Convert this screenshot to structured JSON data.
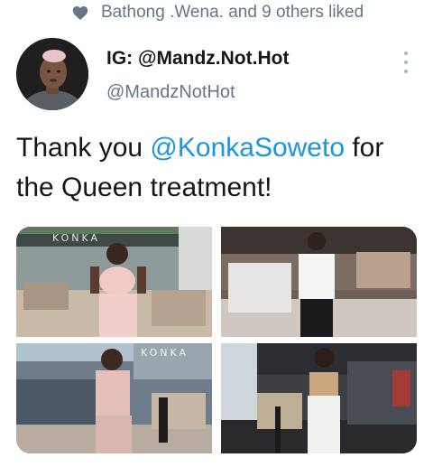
{
  "social_context": {
    "icon": "heart-icon",
    "text": "Bathong .Wena. and 9 others liked"
  },
  "author": {
    "display_name": "IG: @Mandz.Not.Hot",
    "handle": "@MandzNotHot"
  },
  "tweet": {
    "text_before": "Thank you ",
    "mention": "@KonkaSoweto",
    "text_after": " for the Queen treatment!"
  },
  "media": {
    "photos": [
      {
        "sign": "KONKA"
      },
      {
        "sign": ""
      },
      {
        "sign": "KONKA"
      },
      {
        "sign": ""
      }
    ]
  },
  "colors": {
    "link": "#1b95e0",
    "secondary_text": "#657786",
    "primary_text": "#14171a"
  }
}
